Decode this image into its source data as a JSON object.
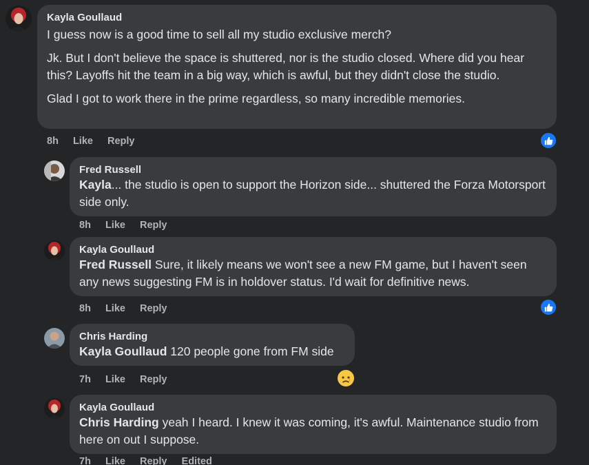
{
  "comments": [
    {
      "author": "Kayla Goullaud",
      "paragraphs": [
        "I guess now is a good time to sell all my studio exclusive merch?",
        "Jk. But I don't believe the space is shuttered, nor is the studio closed. Where did you hear this? Layoffs hit the team in a big way, which is awful, but they didn't close the studio.",
        "Glad I got to work there in the prime regardless, so many incredible memories."
      ],
      "time": "8h",
      "like": "Like",
      "reply": "Reply",
      "reaction": "like-icon"
    },
    {
      "author": "Fred Russell",
      "mention": "Kayla",
      "text": "... the studio is open to support the Horizon side... shuttered the Forza Motorsport side only.",
      "time": "8h",
      "like": "Like",
      "reply": "Reply"
    },
    {
      "author": "Kayla Goullaud",
      "mention": "Fred Russell",
      "text": " Sure, it likely means we won't see a new FM game, but I haven't seen any news suggesting FM is in holdover status. I'd wait for definitive news.",
      "time": "8h",
      "like": "Like",
      "reply": "Reply",
      "reaction": "like-icon"
    },
    {
      "author": "Chris Harding",
      "mention": "Kayla Goullaud",
      "text": " 120 people gone from FM side",
      "time": "7h",
      "like": "Like",
      "reply": "Reply",
      "reaction": "sad-icon"
    },
    {
      "author": "Kayla Goullaud",
      "mention": "Chris Harding",
      "text": " yeah I heard. I knew it was coming, it's awful. Maintenance studio from here on out I suppose.",
      "time": "7h",
      "like": "Like",
      "reply": "Reply",
      "edited": "Edited"
    }
  ],
  "colors": {
    "background": "#242526",
    "bubble": "#3a3b3c",
    "text": "#e4e6eb",
    "meta": "#b0b3b8",
    "like_blue": "#1877f2",
    "sad_yellow": "#f7c844"
  }
}
